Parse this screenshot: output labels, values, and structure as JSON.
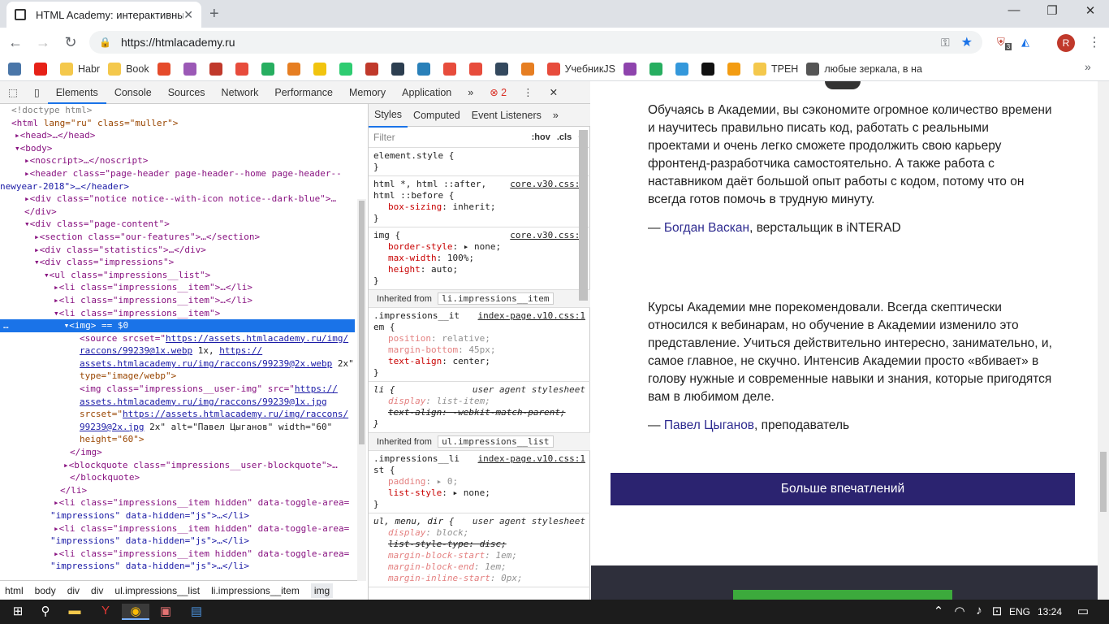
{
  "browser": {
    "tab_title": "HTML Academy: интерактивные",
    "url": "https://htmlacademy.ru",
    "profile_initial": "R",
    "ext_badge": "3"
  },
  "bookmarks": [
    {
      "label": "",
      "color": "#4a76a8"
    },
    {
      "label": "",
      "color": "#e62117"
    },
    {
      "label": "Habr",
      "color": "#f4c84c"
    },
    {
      "label": "Book",
      "color": "#f4c84c"
    },
    {
      "label": "",
      "color": "#e54b2b"
    },
    {
      "label": "",
      "color": "#9b59b6"
    },
    {
      "label": "",
      "color": "#c0392b"
    },
    {
      "label": "",
      "color": "#e74c3c"
    },
    {
      "label": "",
      "color": "#27ae60"
    },
    {
      "label": "",
      "color": "#e67e22"
    },
    {
      "label": "",
      "color": "#f1c40f"
    },
    {
      "label": "",
      "color": "#2ecc71"
    },
    {
      "label": "",
      "color": "#c0392b"
    },
    {
      "label": "",
      "color": "#2c3e50"
    },
    {
      "label": "",
      "color": "#2980b9"
    },
    {
      "label": "",
      "color": "#e74c3c"
    },
    {
      "label": "",
      "color": "#e74c3c"
    },
    {
      "label": "",
      "color": "#34495e"
    },
    {
      "label": "",
      "color": "#e67e22"
    },
    {
      "label": "УчебникJS",
      "color": "#e74c3c"
    },
    {
      "label": "",
      "color": "#8e44ad"
    },
    {
      "label": "",
      "color": "#27ae60"
    },
    {
      "label": "",
      "color": "#3498db"
    },
    {
      "label": "",
      "color": "#111111"
    },
    {
      "label": "",
      "color": "#f39c12"
    },
    {
      "label": "ТРЕН",
      "color": "#f4c84c"
    },
    {
      "label": "любые зеркала, в на",
      "color": "#555555"
    }
  ],
  "devtools": {
    "tabs": [
      "Elements",
      "Console",
      "Sources",
      "Network",
      "Performance",
      "Memory",
      "Application"
    ],
    "error_count": "2",
    "style_tabs": [
      "Styles",
      "Computed",
      "Event Listeners"
    ],
    "filter_placeholder": "Filter",
    "hov": ":hov",
    "cls": ".cls",
    "breadcrumbs": [
      "html",
      "body",
      "div",
      "div",
      "ul.impressions__list",
      "li.impressions__item",
      "img"
    ],
    "dom_lines": {
      "doctype": "<!doctype html>",
      "html_tag": "<html",
      "html_attrs": " lang=\"ru\" class=\"muller\">",
      "head": "<head>…</head>",
      "body": "<body>",
      "noscript": "<noscript>…</noscript>",
      "header1": "<header class=\"page-header page-header--home page-header--",
      "header2": "newyear-2018\">…</header>",
      "notice": "<div class=\"notice notice--with-icon notice--dark-blue\">…",
      "div_close": "</div>",
      "page_content": "<div class=\"page-content\">",
      "our_features": "<section class=\"our-features\">…</section>",
      "statistics": "<div class=\"statistics\">…</div>",
      "impressions": "<div class=\"impressions\">",
      "ul_list": "<ul class=\"impressions__list\">",
      "li_item1": "<li class=\"impressions__item\">…</li>",
      "li_item2": "<li class=\"impressions__item\">…</li>",
      "li_item3": "<li class=\"impressions__item\">",
      "img_sel": "<img> == $0",
      "source1": "<source srcset=\"",
      "source_link1": "https://assets.htmlacademy.ru/img/",
      "source_link1b": "raccons/99239@1x.webp",
      "source_mid": " 1x, ",
      "source_link2": "https://",
      "source_link2b": "assets.htmlacademy.ru/img/raccons/99239@2x.webp",
      "source_end": " 2x\"",
      "source_type": "type=\"image/webp\">",
      "img1": "<img class=\"impressions__user-img\" src=\"",
      "img_link1": "https://",
      "img_link1b": "assets.htmlacademy.ru/img/raccons/99239@1x.jpg",
      "img_srcset": "srcset=\"",
      "img_link2": "https://assets.htmlacademy.ru/img/raccons/",
      "img_link2b": "99239@2x.jpg",
      "img_alt": " 2x\" alt=\"Павел Цыганов\" width=\"60\"",
      "img_height": "height=\"60\">",
      "img_close": "</img>",
      "blockquote": "<blockquote class=\"impressions__user-blockquote\">…",
      "blockquote_close": "</blockquote>",
      "li_close": "</li>",
      "hidden1a": "<li class=\"impressions__item hidden\" data-toggle-area=",
      "hidden1b": "\"impressions\" data-hidden=\"js\">…</li>",
      "hidden2a": "<li class=\"impressions__item hidden\" data-toggle-area=",
      "hidden2b": "\"impressions\" data-hidden=\"js\">…</li>",
      "hidden3a": "<li class=\"impressions__item hidden\" data-toggle-area=",
      "hidden3b": "\"impressions\" data-hidden=\"js\">…</li>"
    },
    "styles": {
      "element_style": "element.style {",
      "close": "}",
      "r1_sel": "html *, html ::after,",
      "r1_sel2": "html ::before {",
      "r1_src": "core.v30.css:1",
      "r1_p": "box-sizing",
      "r1_v": "inherit;",
      "r2_sel": "img {",
      "r2_src": "core.v30.css:1",
      "r2_p1": "border-style",
      "r2_v1": "none;",
      "r2_p2": "max-width",
      "r2_v2": "100%;",
      "r2_p3": "height",
      "r2_v3": "auto;",
      "inh1_label": "Inherited from",
      "inh1_sel": "li.impressions__item",
      "r3_sel": ".impressions__it",
      "r3_sel2": "em {",
      "r3_src": "index-page.v10.css:1",
      "r3_p1": "position",
      "r3_v1": "relative;",
      "r3_p2": "margin-bottom",
      "r3_v2": "45px;",
      "r3_p3": "text-align",
      "r3_v3": "center;",
      "r4_sel": "li {",
      "r4_ua": "user agent stylesheet",
      "r4_p1": "display",
      "r4_v1": "list-item;",
      "r4_p2": "text-align",
      "r4_v2": "-webkit-match-parent;",
      "inh2_label": "Inherited from",
      "inh2_sel": "ul.impressions__list",
      "r5_sel": ".impressions__li",
      "r5_sel2": "st {",
      "r5_src": "index-page.v10.css:1",
      "r5_p1": "padding",
      "r5_v1": "0;",
      "r5_p2": "list-style",
      "r5_v2": "none;",
      "r6_sel": "ul, menu, dir {",
      "r6_ua": "user agent stylesheet",
      "r6_p1": "display",
      "r6_v1": "block;",
      "r6_p2": "list-style-type",
      "r6_v2": "disc;",
      "r6_p3": "margin-block-start",
      "r6_v3": "1em;",
      "r6_p4": "margin-block-end",
      "r6_v4": "1em;",
      "r6_p5": "margin-inline-start",
      "r6_v5": "0px;"
    }
  },
  "page": {
    "quote1": "Обучаясь в Академии, вы сэкономите огромное количество времени и научитесь правильно писать код, работать с реальными проектами и очень легко сможете продолжить свою карьеру фронтенд-разработчика самостоятельно. А также работа с наставником даёт большой опыт работы с кодом, потому что он всегда готов помочь в трудную минуту.",
    "author1_dash": "— ",
    "author1_name": "Богдан Васкан",
    "author1_role": ", верстальщик в iNTERAD",
    "quote2": "Курсы Академии мне порекомендовали. Всегда скептически относился к вебинарам, но обучение в Академии изменило это представление. Учиться действительно интересно, занимательно, и, самое главное, не скучно. Интенсив Академии просто «вбивает» в голову нужные и современные навыки и знания, которые пригодятся вам в любимом деле.",
    "author2_dash": "— ",
    "author2_name": "Павел Цыганов",
    "author2_role": ", преподаватель",
    "more_button": "Больше впечатлений"
  },
  "taskbar": {
    "lang": "ENG",
    "time": "13:24"
  }
}
